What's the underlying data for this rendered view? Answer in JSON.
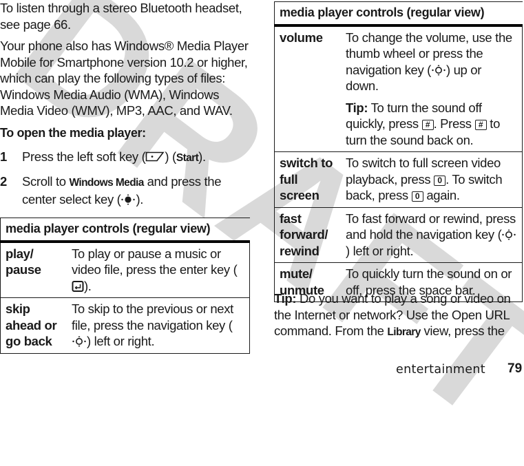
{
  "watermark": "DRAFT",
  "left_column": {
    "paragraph1": "To listen through a stereo Bluetooth headset, see page 66.",
    "paragraph2": "Your phone also has Windows® Media Player Mobile for Smartphone version 10.2 or higher, which can play the following types of files: Windows Media Audio (WMA), Windows Media Video (WMV), MP3, AAC, and WAV.",
    "heading": "To open the media player:",
    "steps": [
      {
        "number": "1",
        "text_before": "Press the left soft key (",
        "key_icon": "left-soft-key-icon",
        "text_middle": ") (",
        "ui_term": "Start",
        "text_after": ")."
      },
      {
        "number": "2",
        "text_before": "Scroll to ",
        "ui_term": "Windows Media",
        "text_middle": " and press the center select key (",
        "key_icon": "center-select-key-icon",
        "text_after": ")."
      }
    ],
    "table": {
      "header": "media player controls (regular view)",
      "rows": [
        {
          "label": "play/ pause",
          "desc_before": "To play or pause a music or video file, press the enter key (",
          "key_icon": "enter-key-icon",
          "desc_after": ")."
        },
        {
          "label": "skip ahead or go back",
          "desc_before": "To skip to the previous or next file, press the navigation key (",
          "key_icon": "navigation-key-icon",
          "desc_after": ") left or right."
        }
      ]
    }
  },
  "right_column": {
    "table": {
      "header": "media player controls (regular view)",
      "rows": [
        {
          "label": "volume",
          "desc_before": "To change the volume, use the thumb wheel or press the navigation key (",
          "key_icon": "navigation-key-icon",
          "desc_after": ") up or down.",
          "tip_label": "Tip:",
          "tip_before": " To turn the sound off quickly, press ",
          "tip_key1": "#",
          "tip_middle": ". Press ",
          "tip_key2": "#",
          "tip_after": "  to turn the sound back on."
        },
        {
          "label": "switch to full screen",
          "desc_before": "To switch to full screen video playback, press ",
          "key1": "0",
          "desc_middle": ". To switch back, press ",
          "key2": "0",
          "desc_after": "  again."
        },
        {
          "label": "fast forward/ rewind",
          "desc_before": "To fast forward or rewind, press and hold the navigation key (",
          "key_icon": "navigation-key-icon",
          "desc_after": ") left or right."
        },
        {
          "label": "mute/ unmute",
          "desc": "To quickly turn the sound on or off, press the space bar."
        }
      ]
    },
    "tip": {
      "label": "Tip:",
      "text_before": " Do you want to play a song or video on the Internet or network? Use the Open URL command. From the ",
      "ui_term": "Library",
      "text_after": " view, press the"
    }
  },
  "footer": {
    "section": "entertainment",
    "page_number": "79"
  }
}
